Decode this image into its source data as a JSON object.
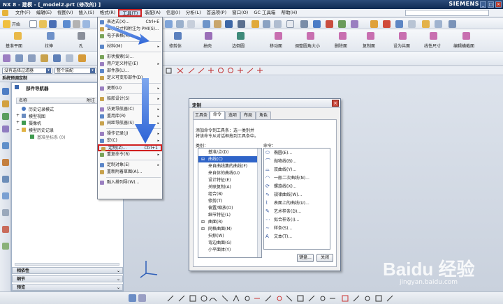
{
  "window": {
    "title": "NX 8 - 建模 - [_model2.prt  (修改的) ]",
    "brand": "SIEMENS",
    "controls": [
      "_",
      "□",
      "×"
    ]
  },
  "menubar": {
    "items": [
      "文件(F)",
      "编辑(E)",
      "视图(V)",
      "插入(S)",
      "格式(R)",
      "工具(T)",
      "装配(A)",
      "信息(I)",
      "分析(L)",
      "首选项(P)",
      "窗口(O)",
      "GC 工具箱",
      "帮助(H)"
    ],
    "open_index": 5
  },
  "toolbar1": {
    "start_label": "开始"
  },
  "toolbar2": {
    "items": [
      "基准平面",
      "拉伸",
      "孔",
      "修剪体",
      "抽壳",
      "边倒圆",
      "移动面",
      "调整圆角大小",
      "删除面",
      "复制面",
      "设为共面",
      "线性尺寸",
      "编辑横截面"
    ]
  },
  "filterbar": {
    "filter": "没有选择过滤器",
    "scope": "整个装配"
  },
  "resource_bar_title": "系统预调定制",
  "navigator": {
    "title": "部件导航器",
    "col_name": "名称",
    "col_ref": "附注",
    "tree": [
      {
        "label": "历史记录模式",
        "indent": 0
      },
      {
        "label": "模型视图",
        "indent": 0
      },
      {
        "label": "摄像机",
        "indent": 0
      },
      {
        "label": "模型历史记录",
        "indent": 0
      },
      {
        "label": "基准坐标系 (0)",
        "indent": 1
      }
    ],
    "bottom_sections": [
      "相依性",
      "细节",
      "预览"
    ]
  },
  "tools_menu": {
    "items": [
      {
        "label": "表达式(X)...",
        "shortcut": "Ctrl+E"
      },
      {
        "label": "显示尺寸和附注为 PMI(S)..."
      },
      {
        "label": "电子表格(H)..."
      },
      {
        "sep": true
      },
      {
        "label": "材料(M)",
        "submenu": true
      },
      {
        "sep": true
      },
      {
        "label": "形状搜索(S)..."
      },
      {
        "label": "用户定义特征(E)",
        "submenu": true
      },
      {
        "label": "部件族(L)..."
      },
      {
        "label": "定义可变形部件(D)..."
      },
      {
        "sep": true
      },
      {
        "label": "更新(U)",
        "submenu": true
      },
      {
        "sep": true
      },
      {
        "label": "船舶设计(S)",
        "submenu": true
      },
      {
        "sep": true
      },
      {
        "label": "仿更导航器(C)",
        "submenu": true
      },
      {
        "label": "重用库(R)",
        "submenu": true
      },
      {
        "label": "间距导航器(S)",
        "submenu": true
      },
      {
        "sep": true
      },
      {
        "label": "操作记录(J)",
        "submenu": true
      },
      {
        "label": "宏(C)",
        "submenu": true
      },
      {
        "label": "定制(Z)...",
        "shortcut": "Ctrl+1",
        "highlight": true
      },
      {
        "label": "重复命令(R)",
        "submenu": true
      },
      {
        "sep": true
      },
      {
        "label": "定制对象(E)",
        "submenu": true
      },
      {
        "label": "重新附着草图(A)..."
      },
      {
        "sep": true
      },
      {
        "label": "融入排列导(W)..."
      }
    ]
  },
  "dialog": {
    "title": "定制",
    "tabs": [
      "工具条",
      "命令",
      "选项",
      "布局",
      "角色"
    ],
    "active_tab": 1,
    "instruction_1": "添加命令到工具条：选一类别并",
    "instruction_2": "将该命令从对话框拖到工具条中。",
    "category_label": "类别：",
    "command_label": "命令：",
    "categories": [
      "基准/点(D)",
      "曲线(C)",
      "来自曲线集的曲线(F)",
      "来自体的曲线(U)",
      "设计特征(E)",
      "关联复制(A)",
      "组合(B)",
      "修剪(T)",
      "偏置/缩放(O)",
      "细节特征(L)",
      "曲面(R)",
      "网格曲面(M)",
      "扫掠(W)",
      "弯边曲面(G)",
      "小平面体(Y)"
    ],
    "selected_category": 1,
    "commands": [
      "椭圆(E)...",
      "抛物线(B)...",
      "双曲线(Y)...",
      "一般二次曲线(N)...",
      "螺旋线(X)...",
      "规律曲线(W)...",
      "表面上的曲线(U)...",
      "艺术样条(D)...",
      "拟合样条(I)...",
      "样条(S)...",
      "文本(T)..."
    ],
    "keyboard_button": "键盘...",
    "close_button": "关闭"
  },
  "watermark": {
    "brand": "Baidu 经验",
    "url": "jingyan.baidu.com"
  },
  "colors": {
    "accent_red": "#d02020",
    "title_blue": "#1a3561",
    "arrow_blue": "#2c63d6"
  }
}
